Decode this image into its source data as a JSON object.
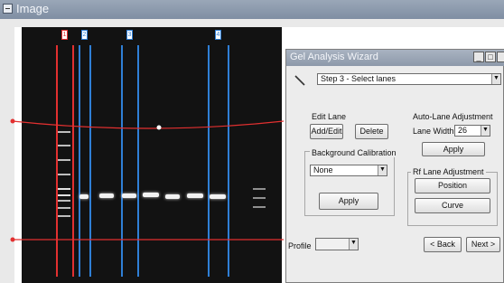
{
  "window": {
    "title": "Image"
  },
  "lane_tabs": [
    {
      "label": "1",
      "color": "#e23030"
    },
    {
      "label": "2",
      "color": "#2f7fd6"
    },
    {
      "label": "3",
      "color": "#2f7fd6"
    },
    {
      "label": "4",
      "color": "#2f7fd6"
    }
  ],
  "wizard": {
    "title": "Gel Analysis Wizard",
    "step_label": "Step 3 - Select lanes",
    "edit_lane": {
      "title": "Edit Lane",
      "add_label": "Add/Edit",
      "delete_label": "Delete"
    },
    "background": {
      "title": "Background Calibration",
      "method": "None",
      "apply_label": "Apply"
    },
    "auto_lane": {
      "title": "Auto-Lane Adjustment",
      "width_label": "Lane Width",
      "width_value": "26",
      "apply_label": "Apply"
    },
    "rf_lane": {
      "title": "Rf Lane Adjustment",
      "position_label": "Position",
      "curve_label": "Curve"
    },
    "profile_label": "Profile",
    "back_label": "< Back",
    "next_label": "Next >"
  },
  "colors": {
    "reference_line": "#e23030",
    "lane_marker": "#2f7fd6",
    "gel": "#121212"
  }
}
